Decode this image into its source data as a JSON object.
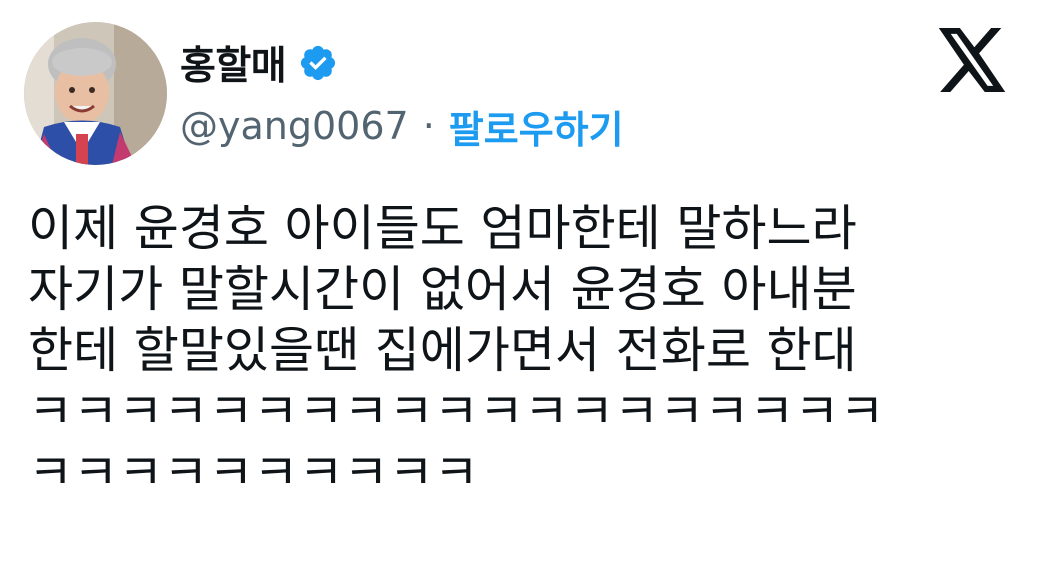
{
  "author": {
    "name": "홍할매",
    "handle": "@yang0067",
    "separator": "·",
    "follow_label": "팔로우하기",
    "verified_icon": "verified-badge-icon",
    "verified_color": "#1d9bf0"
  },
  "platform": {
    "logo_icon": "x-logo-icon"
  },
  "tweet": {
    "lines": [
      "이제 윤경호 아이들도 엄마한테 말하느라",
      "자기가 말할시간이 없어서 윤경호 아내분",
      "한테 할말있을땐 집에가면서 전화로 한대",
      "ㅋㅋㅋㅋㅋㅋㅋㅋㅋㅋㅋㅋㅋㅋㅋㅋㅋㅋㅋ",
      "ㅋㅋㅋㅋㅋㅋㅋㅋㅋㅋ"
    ]
  },
  "colors": {
    "text_primary": "#0f1419",
    "text_secondary": "#536471",
    "accent": "#1d9bf0",
    "background": "#ffffff"
  }
}
